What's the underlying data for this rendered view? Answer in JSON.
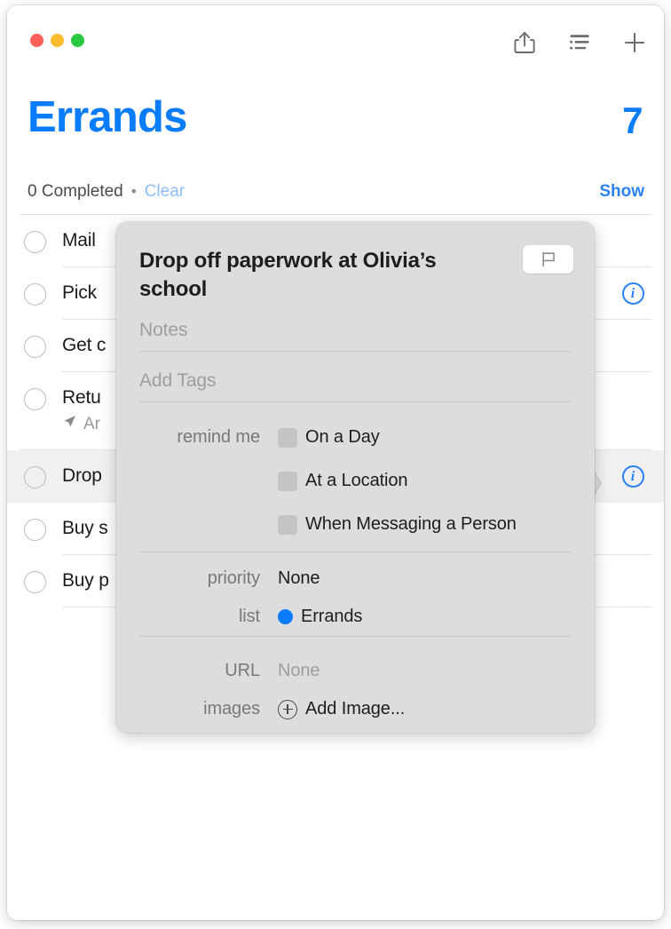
{
  "window": {
    "traffic_lights": [
      {
        "name": "close-button",
        "color": "#FF5F57"
      },
      {
        "name": "minimize-button",
        "color": "#FEBC2E"
      },
      {
        "name": "zoom-button",
        "color": "#28C840"
      }
    ],
    "toolbar": [
      {
        "name": "share-icon",
        "label": "Share"
      },
      {
        "name": "sort-list-icon",
        "label": "View Options"
      },
      {
        "name": "plus-icon",
        "label": "New Reminder"
      }
    ]
  },
  "header": {
    "title": "Errands",
    "count": "7",
    "completed_text": "0 Completed",
    "separator": "•",
    "clear_label": "Clear",
    "show_label": "Show",
    "title_color": "#0A7CFF"
  },
  "reminders": [
    {
      "title": "Mail ",
      "subtitle": "",
      "info": false,
      "selected": false,
      "truncated": true
    },
    {
      "title": "Pick ",
      "subtitle": "",
      "info": true,
      "selected": false,
      "truncated": true
    },
    {
      "title": "Get c",
      "subtitle": "",
      "info": false,
      "selected": false,
      "truncated": true
    },
    {
      "title": "Retu",
      "subtitle": "Ar",
      "info": false,
      "selected": false,
      "truncated": true,
      "location_icon": "location-arrow-icon"
    },
    {
      "title": "Drop",
      "subtitle": "",
      "info": true,
      "selected": true,
      "truncated": true
    },
    {
      "title": "Buy s",
      "subtitle": "",
      "info": false,
      "selected": false,
      "truncated": true
    },
    {
      "title": "Buy p",
      "subtitle": "",
      "info": false,
      "selected": false,
      "truncated": true
    }
  ],
  "popover": {
    "title": "Drop off paperwork at Olivia’s school",
    "flag_button": "flag-icon",
    "notes_placeholder": "Notes",
    "tags_placeholder": "Add Tags",
    "remind_me_label": "remind me",
    "remind_options": [
      {
        "label": "On a Day",
        "checked": false
      },
      {
        "label": "At a Location",
        "checked": false
      },
      {
        "label": "When Messaging a Person",
        "checked": false
      }
    ],
    "priority_label": "priority",
    "priority_value": "None",
    "list_label": "list",
    "list_value": "Errands",
    "list_color": "#0A7CFF",
    "url_label": "URL",
    "url_value": "None",
    "images_label": "images",
    "add_image_label": "Add Image..."
  }
}
